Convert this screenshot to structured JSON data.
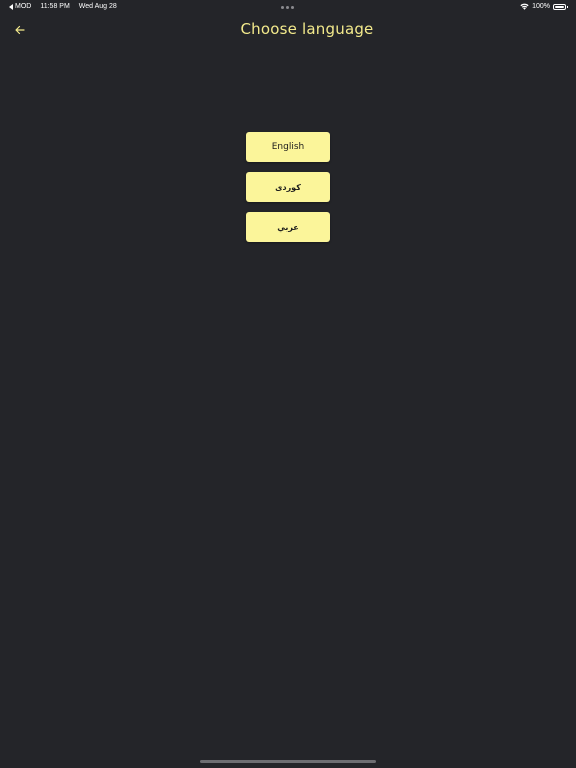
{
  "status_bar": {
    "back_app": "MOD",
    "time": "11:58 PM",
    "date": "Wed Aug 28",
    "battery": "100%",
    "icons": [
      "back-triangle-icon",
      "multitask-dots-icon",
      "wifi-icon",
      "battery-icon"
    ]
  },
  "header": {
    "title": "Choose language",
    "back_icon": "arrow-left-icon"
  },
  "languages": [
    {
      "label": "English"
    },
    {
      "label": "کوردی"
    },
    {
      "label": "عربي"
    }
  ],
  "colors": {
    "background": "#242529",
    "accent": "#f3ea8c",
    "button_bg": "#fbf59a",
    "button_text": "#1d1d1d"
  }
}
